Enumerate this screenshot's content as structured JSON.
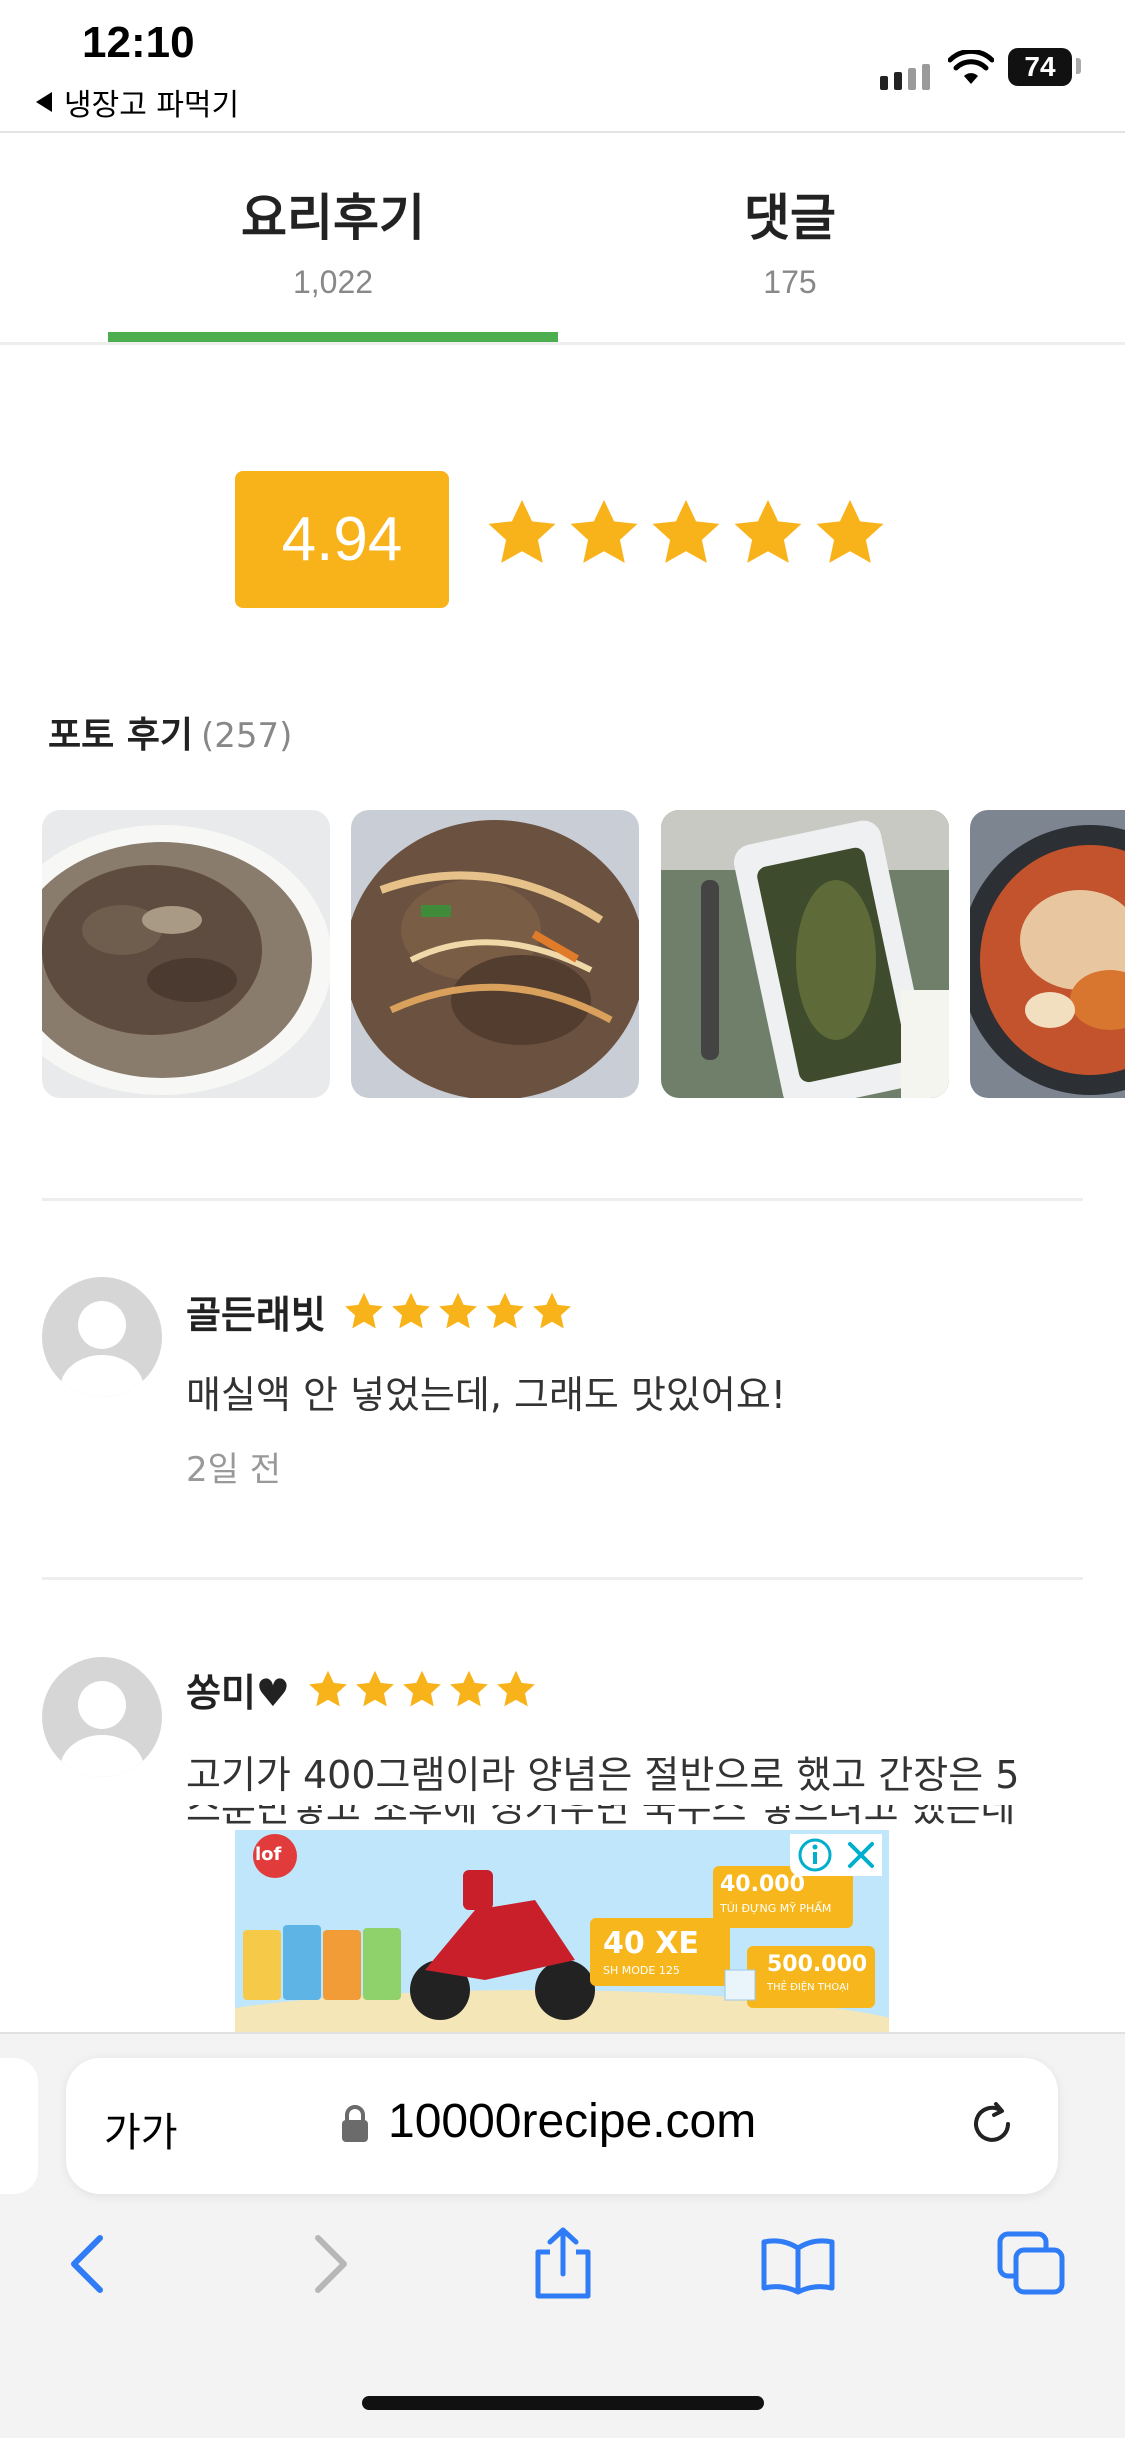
{
  "status_bar": {
    "time": "12:10",
    "back_app": "냉장고 파먹기",
    "battery": "74"
  },
  "tabs": [
    {
      "label": "요리후기",
      "count": "1,022",
      "active": true
    },
    {
      "label": "댓글",
      "count": "175",
      "active": false
    }
  ],
  "rating": {
    "score": "4.94",
    "stars": 5
  },
  "photo_reviews": {
    "title": "포토 후기",
    "count": "(257)"
  },
  "reviews": [
    {
      "name": "골든래빗",
      "stars": 5,
      "text": "매실액 안 넣었는데, 그래도 맛있어요!",
      "time": "2일 전"
    },
    {
      "name": "쏭미♥",
      "stars": 5,
      "text": "고기가 400그램이라 양념은 절반으로 했고 간장은 5",
      "text_line2": "스푼만넣고 초후에 싱거우면 국수스 넣으려고 했는데"
    }
  ],
  "ad": {
    "brand": "lof",
    "promo_1_value": "40.000",
    "promo_1_caption": "TÚI ĐỰNG MỸ PHẨM",
    "promo_2_value": "40 XE",
    "promo_2_caption": "SH MODE 125",
    "promo_3_value": "500.000",
    "promo_3_caption": "THẺ ĐIỆN THOẠI"
  },
  "browser": {
    "text_size_label": "가가",
    "url": "10000recipe.com"
  },
  "colors": {
    "accent_green": "#4cae4f",
    "rating_orange": "#f9b31a",
    "ios_blue": "#2f7cf6"
  }
}
